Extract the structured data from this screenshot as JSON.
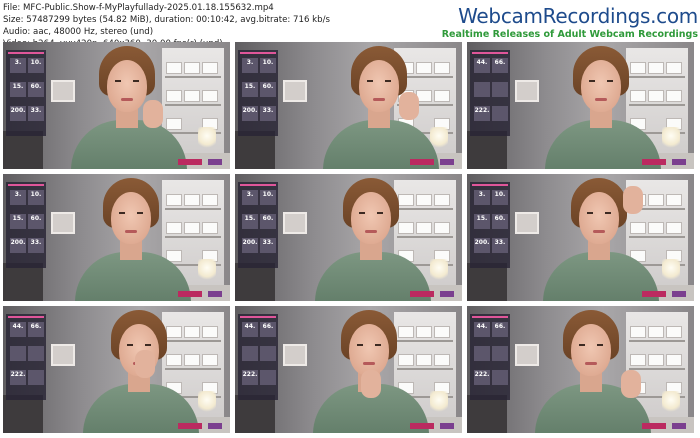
{
  "info": {
    "file": "File: MFC-Public.Show-f-MyPlayfullady-2025.01.18.155632.mp4",
    "size": "Size: 57487299 bytes (54.82 MiB), duration: 00:10:42, avg.bitrate: 716 kb/s",
    "audio": "Audio: aac, 48000 Hz, stereo (und)",
    "video": "Video: h264, yuv420p, 640x360, 30.00 fps(r) (und)"
  },
  "brand": {
    "name": "WebcamRecordings.com",
    "tagline": "Realtime Releases of Adult Webcam Recordings",
    "color": "#1e4b8c",
    "tagline_color": "#2f9a3a"
  },
  "thumbnails": [
    {
      "pose": "hand-on-chin",
      "menu": [
        "3.",
        "10.",
        "15.",
        "60.",
        "200.",
        "33."
      ]
    },
    {
      "pose": "smile-hand-cheek",
      "menu": [
        "3.",
        "10.",
        "15.",
        "60.",
        "200.",
        "33."
      ]
    },
    {
      "pose": "talking",
      "menu": [
        "44.",
        "66.",
        "",
        "",
        "222.",
        ""
      ]
    },
    {
      "pose": "eyes-down",
      "menu": [
        "3.",
        "10.",
        "15.",
        "60.",
        "200.",
        "33."
      ]
    },
    {
      "pose": "leaning-smile",
      "menu": [
        "3.",
        "10.",
        "15.",
        "60.",
        "200.",
        "33."
      ]
    },
    {
      "pose": "hand-in-hair",
      "menu": [
        "3.",
        "10.",
        "15.",
        "60.",
        "200.",
        "33."
      ]
    },
    {
      "pose": "hand-to-nose",
      "menu": [
        "44.",
        "66.",
        "",
        "",
        "222.",
        ""
      ]
    },
    {
      "pose": "chin-on-hand",
      "menu": [
        "44.",
        "66.",
        "",
        "",
        "222.",
        ""
      ]
    },
    {
      "pose": "gesturing",
      "menu": [
        "44.",
        "66.",
        "",
        "",
        "222.",
        ""
      ]
    }
  ]
}
